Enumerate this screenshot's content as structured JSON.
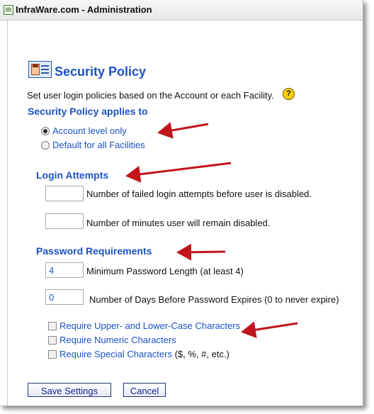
{
  "window": {
    "title": "InfraWare.com - Administration"
  },
  "page": {
    "title": "Security Policy",
    "description": "Set user login policies based on the Account or each Facility.",
    "help_glyph": "?"
  },
  "applies_to": {
    "heading": "Security Policy applies to",
    "options": [
      {
        "label": "Account level only",
        "selected": true
      },
      {
        "label": "Default for all Facilities",
        "selected": false
      }
    ]
  },
  "login_attempts": {
    "heading": "Login Attempts",
    "failed_attempts": {
      "value": "",
      "label": "Number of failed login attempts before user is disabled."
    },
    "disabled_minutes": {
      "value": "",
      "label": "Number of minutes user will remain disabled."
    }
  },
  "password": {
    "heading": "Password Requirements",
    "min_length": {
      "value": "4",
      "label": "Minimum Password Length (at least 4)"
    },
    "expire_days": {
      "value": "0",
      "label": "Number of Days Before Password Expires (0 to never expire)"
    },
    "checkboxes": [
      {
        "label": "Require Upper- and Lower-Case Characters",
        "suffix": "",
        "checked": false
      },
      {
        "label": "Require Numeric Characters",
        "suffix": "",
        "checked": false
      },
      {
        "label": "Require Special Characters",
        "suffix": " ($, %, #, etc.)",
        "checked": false
      }
    ]
  },
  "buttons": {
    "save": "Save Settings",
    "cancel": "Cancel"
  },
  "annotations": {
    "arrow_color": "#c0151b"
  }
}
